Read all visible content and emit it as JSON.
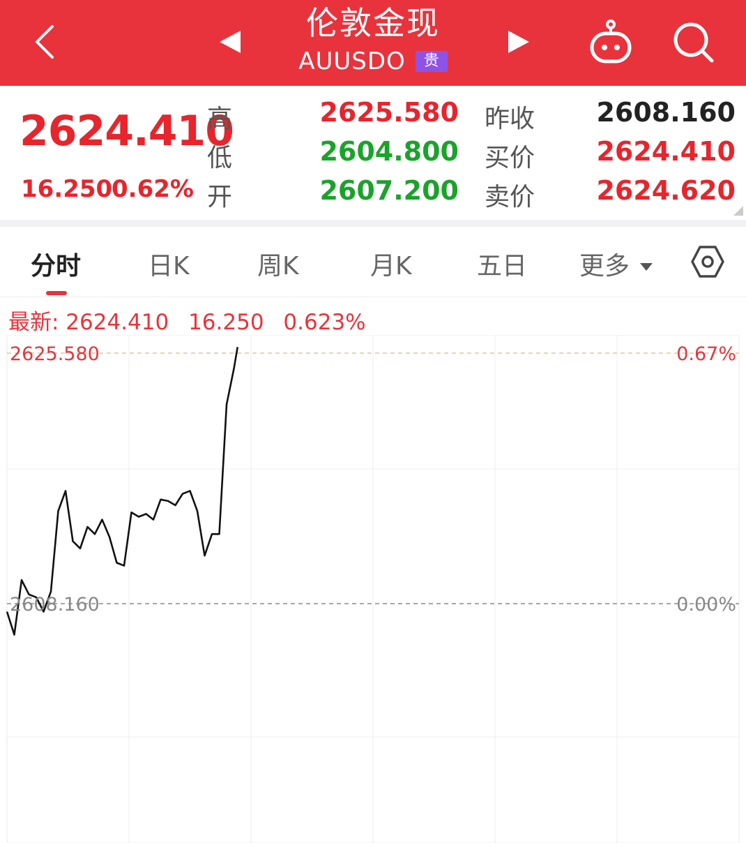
{
  "header": {
    "title": "伦敦金现",
    "symbol": "AUUSDO",
    "badge": "贵"
  },
  "quote": {
    "price": "2624.410",
    "change": "16.250",
    "change_pct": "0.62%",
    "high_label": "高",
    "low_label": "低",
    "open_label": "开",
    "high": "2625.580",
    "low": "2604.800",
    "open": "2607.200",
    "prev_close_label": "昨收",
    "bid_label": "买价",
    "ask_label": "卖价",
    "prev_close": "2608.160",
    "bid": "2624.410",
    "ask": "2624.620"
  },
  "tabs": [
    {
      "label": "分时",
      "active": true
    },
    {
      "label": "日K"
    },
    {
      "label": "周K"
    },
    {
      "label": "月K"
    },
    {
      "label": "五日"
    },
    {
      "label": "更多"
    }
  ],
  "latest": {
    "label": "最新: 2624.410",
    "change": "16.250",
    "change_pct": "0.623%"
  },
  "colors": {
    "header_bg": "#e8333c",
    "up": "#e8242c",
    "down": "#1aa32a",
    "badge": "#8f52e8"
  },
  "icons": [
    "back-icon",
    "prev-icon",
    "next-icon",
    "robot-icon",
    "search-icon",
    "settings-hex-icon",
    "dropdown-arrow-icon"
  ],
  "chart_data": {
    "type": "line",
    "x": [
      0,
      2,
      4,
      6,
      8,
      10,
      12,
      14,
      16,
      18,
      20,
      22,
      24,
      26,
      28,
      30,
      32,
      34,
      36,
      38,
      40,
      42,
      44,
      46,
      48,
      50,
      52,
      54,
      56,
      58,
      60,
      62,
      63
    ],
    "y": [
      2607.6,
      2606.0,
      2609.8,
      2608.8,
      2608.6,
      2607.6,
      2609.0,
      2614.6,
      2616.0,
      2612.5,
      2612.0,
      2613.5,
      2613.0,
      2614.0,
      2612.8,
      2611.0,
      2610.8,
      2614.5,
      2614.2,
      2614.4,
      2614.0,
      2615.4,
      2615.3,
      2615.0,
      2615.8,
      2616.0,
      2614.6,
      2611.5,
      2613.0,
      2613.0,
      2622.0,
      2624.5,
      2626.0
    ],
    "reference_value": 2608.16,
    "ylim": [
      2590.74,
      2625.58
    ],
    "y_tick_labels_left": [
      "2625.580",
      "2608.160"
    ],
    "y_tick_labels_right": [
      "0.67%",
      "0.00%"
    ],
    "grid": true
  }
}
